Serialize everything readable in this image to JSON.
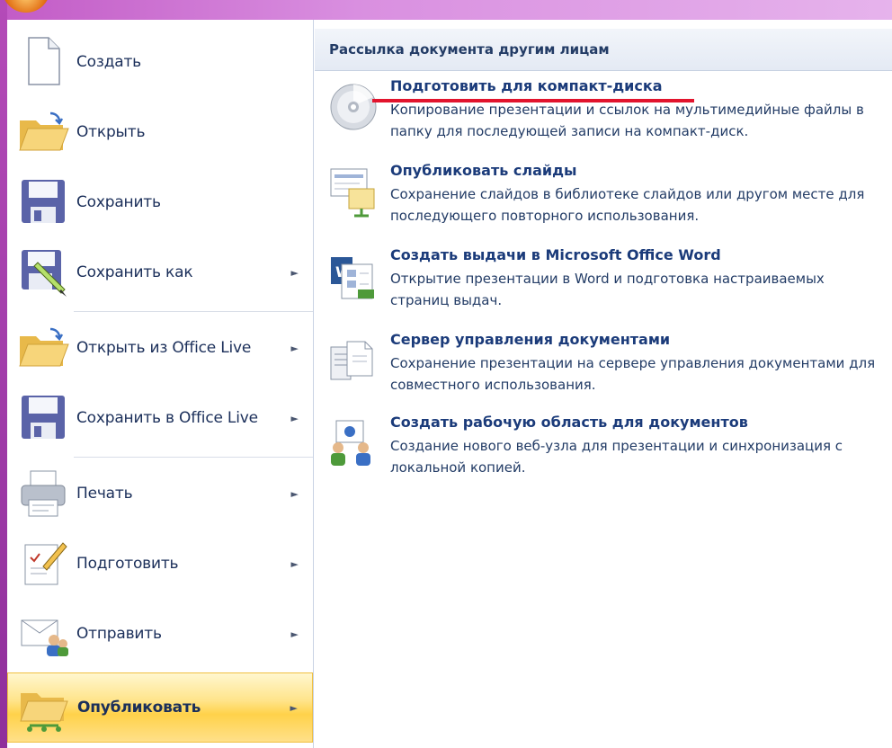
{
  "menu": {
    "items": [
      {
        "label": "Создать",
        "icon": "new-document-icon",
        "submenu": false
      },
      {
        "label": "Открыть",
        "icon": "open-folder-icon",
        "submenu": false
      },
      {
        "label": "Сохранить",
        "icon": "save-icon",
        "submenu": false
      },
      {
        "label": "Сохранить как",
        "icon": "save-as-icon",
        "submenu": true
      },
      {
        "label": "Открыть из Office Live",
        "icon": "open-folder-icon",
        "submenu": true
      },
      {
        "label": "Сохранить в Office Live",
        "icon": "save-icon",
        "submenu": true
      },
      {
        "label": "Печать",
        "icon": "printer-icon",
        "submenu": true
      },
      {
        "label": "Подготовить",
        "icon": "prepare-icon",
        "submenu": true
      },
      {
        "label": "Отправить",
        "icon": "send-icon",
        "submenu": true
      },
      {
        "label": "Опубликовать",
        "icon": "publish-icon",
        "submenu": true,
        "active": true
      }
    ],
    "arrow_glyph": "►"
  },
  "panel": {
    "header": "Рассылка документа другим лицам",
    "entries": [
      {
        "title": "Подготовить для компакт-диска",
        "description": "Копирование презентации и ссылок на мультимедийные файлы в папку для последующей записи на компакт-диск.",
        "icon": "cd-icon"
      },
      {
        "title": "Опубликовать слайды",
        "description": "Сохранение слайдов в библиотеке слайдов или другом месте для последующего повторного использования.",
        "icon": "slides-library-icon"
      },
      {
        "title": "Создать выдачи в Microsoft Office Word",
        "description": "Открытие презентации в Word и подготовка настраиваемых страниц выдач.",
        "icon": "word-handouts-icon"
      },
      {
        "title": "Сервер управления документами",
        "description": "Сохранение презентации на сервере управления документами для совместного использования.",
        "icon": "document-server-icon"
      },
      {
        "title": "Создать рабочую область для документов",
        "description": "Создание нового веб-узла для презентации и синхронизация с локальной копией.",
        "icon": "workspace-icon"
      }
    ]
  },
  "colors": {
    "accent_highlight": "#ffd24a",
    "frame": "#c25bc6",
    "annotation": "#e2142d"
  }
}
